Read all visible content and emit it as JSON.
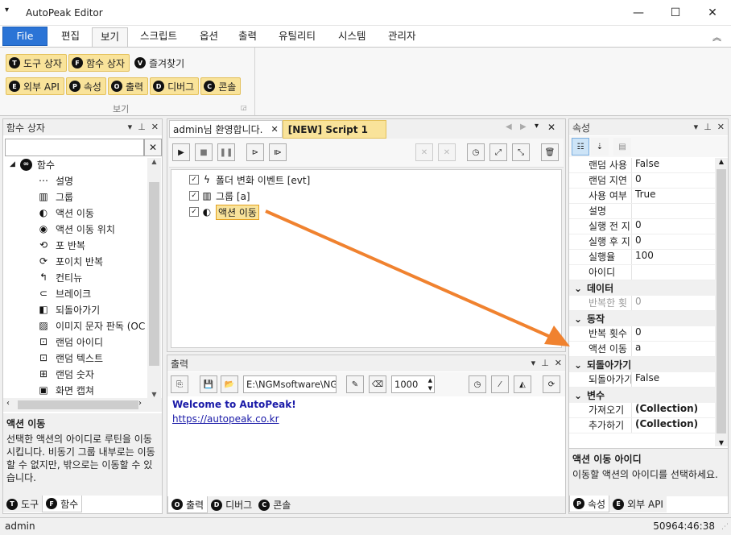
{
  "app": {
    "title": "AutoPeak Editor",
    "quick_access": "▾"
  },
  "window": {
    "minimize": "—",
    "maximize": "☐",
    "close": "✕"
  },
  "ribbon": {
    "tabs": [
      "File",
      "편집",
      "보기",
      "스크립트",
      "옵션",
      "출력",
      "유틸리티",
      "시스템",
      "관리자"
    ],
    "collapse": "︽",
    "group_label": "보기",
    "row1": [
      {
        "badge": "T",
        "label": "도구 상자"
      },
      {
        "badge": "F",
        "label": "함수 상자"
      },
      {
        "badge": "V",
        "label": "즐겨찾기"
      }
    ],
    "row2": [
      {
        "badge": "E",
        "label": "외부 API"
      },
      {
        "badge": "P",
        "label": "속성"
      },
      {
        "badge": "O",
        "label": "출력"
      },
      {
        "badge": "D",
        "label": "디버그"
      },
      {
        "badge": "C",
        "label": "콘솔"
      }
    ]
  },
  "left_panel": {
    "title": "함수 상자",
    "search_value": "",
    "clear": "✕",
    "root": "함수",
    "items": [
      {
        "icon": "⋯",
        "label": "설명"
      },
      {
        "icon": "▥",
        "label": "그룹"
      },
      {
        "icon": "◐",
        "label": "액션 이동"
      },
      {
        "icon": "◉",
        "label": "액션 이동 위치"
      },
      {
        "icon": "⟲",
        "label": "포 반복"
      },
      {
        "icon": "⟳",
        "label": "포이치 반복"
      },
      {
        "icon": "↰",
        "label": "컨티뉴"
      },
      {
        "icon": "⊂",
        "label": "브레이크"
      },
      {
        "icon": "◧",
        "label": "되돌아가기"
      },
      {
        "icon": "▨",
        "label": "이미지 문자 판독 (OC"
      },
      {
        "icon": "⊡",
        "label": "랜덤 아이디"
      },
      {
        "icon": "⊡",
        "label": "랜덤 텍스트"
      },
      {
        "icon": "⊞",
        "label": "랜덤 숫자"
      },
      {
        "icon": "▣",
        "label": "화면 캡쳐"
      }
    ],
    "desc_title": "액션 이동",
    "desc_text": "선택한 액션의 아이디로 루틴을 이동시킵니다. 비동기 그룹 내부로는 이동할 수 없지만, 밖으로는 이동할 수 있습니다.",
    "tabs": [
      {
        "badge": "T",
        "label": "도구"
      },
      {
        "badge": "F",
        "label": "함수"
      }
    ]
  },
  "editor": {
    "tabs": [
      {
        "label": "admin님 환영합니다."
      },
      {
        "label": "[NEW] Script 1"
      }
    ],
    "script": [
      {
        "icon": "ϟ",
        "label": "폴더 변화 이벤트 [evt]"
      },
      {
        "icon": "▥",
        "label": "그룹 [a]"
      },
      {
        "icon": "◐",
        "label": "액션 이동"
      }
    ]
  },
  "output": {
    "title": "출력",
    "path": "E:\\NGMsoftware\\NG",
    "limit": "1000",
    "lines": [
      "Welcome to AutoPeak!",
      "https://autopeak.co.kr"
    ],
    "tabs": [
      {
        "badge": "O",
        "label": "출력"
      },
      {
        "badge": "D",
        "label": "디버그"
      },
      {
        "badge": "C",
        "label": "콘솔"
      }
    ]
  },
  "properties": {
    "title": "속성",
    "rows_top": [
      {
        "k": "랜덤 사용",
        "v": "False"
      },
      {
        "k": "랜덤 지연",
        "v": "0"
      },
      {
        "k": "사용 여부",
        "v": "True"
      },
      {
        "k": "설명",
        "v": ""
      },
      {
        "k": "실행 전 지",
        "v": "0"
      },
      {
        "k": "실행 후 지",
        "v": "0"
      },
      {
        "k": "실행율",
        "v": "100"
      },
      {
        "k": "아이디",
        "v": ""
      }
    ],
    "cat_data": "데이터",
    "rows_data": [
      {
        "k": "반복한 횟",
        "v": "0"
      }
    ],
    "cat_action": "동작",
    "rows_action": [
      {
        "k": "반복 횟수",
        "v": "0"
      },
      {
        "k": "액션 이동",
        "v": "a"
      }
    ],
    "cat_return": "되돌아가기",
    "rows_return": [
      {
        "k": "되돌아가기",
        "v": "False"
      }
    ],
    "cat_vars": "변수",
    "rows_vars": [
      {
        "k": "가져오기",
        "v": "(Collection)"
      },
      {
        "k": "추가하기",
        "v": "(Collection)"
      }
    ],
    "desc_title": "액션 이동 아이디",
    "desc_text": "이동할 액션의 아이디를 선택하세요.",
    "tabs": [
      {
        "badge": "P",
        "label": "속성"
      },
      {
        "badge": "E",
        "label": "외부 API"
      }
    ]
  },
  "status": {
    "user": "admin",
    "time": "50964:46:38"
  },
  "colors": {
    "accent": "#2b74d6",
    "arrow": "#f0822f",
    "highlight": "#f9e39a"
  }
}
